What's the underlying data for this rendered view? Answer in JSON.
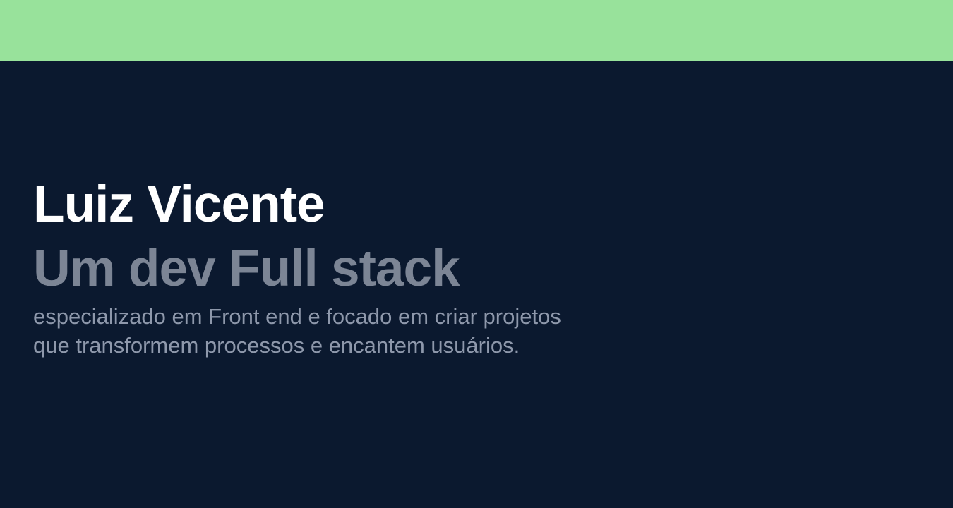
{
  "colors": {
    "header_bar": "#98e29b",
    "background": "#0b192f",
    "name_text": "#ffffff",
    "role_text": "#7c8595",
    "description_text": "#8e98ab"
  },
  "hero": {
    "name": "Luiz Vicente",
    "role": "Um dev Full stack",
    "description_line_1": "especializado em Front end e focado em criar projetos",
    "description_line_2": "que transformem processos e encantem usuários."
  }
}
